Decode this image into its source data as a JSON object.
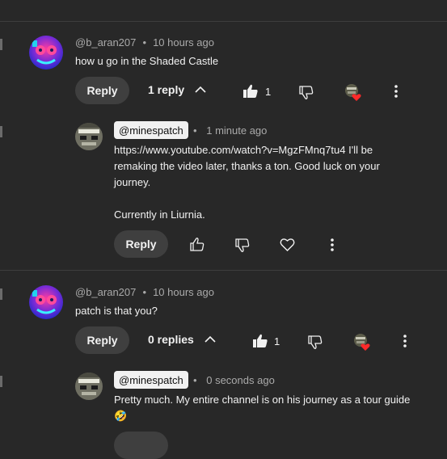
{
  "comments": [
    {
      "handle": "@b_aran207",
      "time": "10 hours ago",
      "text": "how u go in the Shaded Castle",
      "reply_label": "Reply",
      "replies_label": "1 reply",
      "likes": "1",
      "icons": [
        "thumbs-up-icon",
        "thumbs-down-icon",
        "hearted-by-creator-icon",
        "more-vert-icon",
        "chevron-up-icon"
      ],
      "reply": {
        "handle": "@minespatch",
        "time": "1 minute ago",
        "text_lines": [
          "https://www.youtube.com/watch?v=MgzFMnq7tu4 I'll be",
          "remaking the video later, thanks a ton. Good luck on your",
          "journey.",
          "",
          "Currently in Liurnia."
        ],
        "reply_label": "Reply",
        "icons": [
          "thumbs-up-icon",
          "thumbs-down-icon",
          "heart-icon",
          "more-vert-icon"
        ]
      }
    },
    {
      "handle": "@b_aran207",
      "time": "10 hours ago",
      "text": "patch is that you?",
      "reply_label": "Reply",
      "replies_label": "0 replies",
      "likes": "1",
      "icons": [
        "thumbs-up-icon",
        "thumbs-down-icon",
        "hearted-by-creator-icon",
        "more-vert-icon",
        "chevron-up-icon"
      ],
      "reply": {
        "handle": "@minespatch",
        "time": "0 seconds ago",
        "text_lines": [
          "Pretty much. My entire channel is on his journey as a tour guide",
          "🤣"
        ]
      }
    }
  ],
  "colors": {
    "background": "#282828",
    "pill": "#3f3f3f",
    "meta": "#aaaaaa",
    "heart": "#ff2a2a"
  }
}
